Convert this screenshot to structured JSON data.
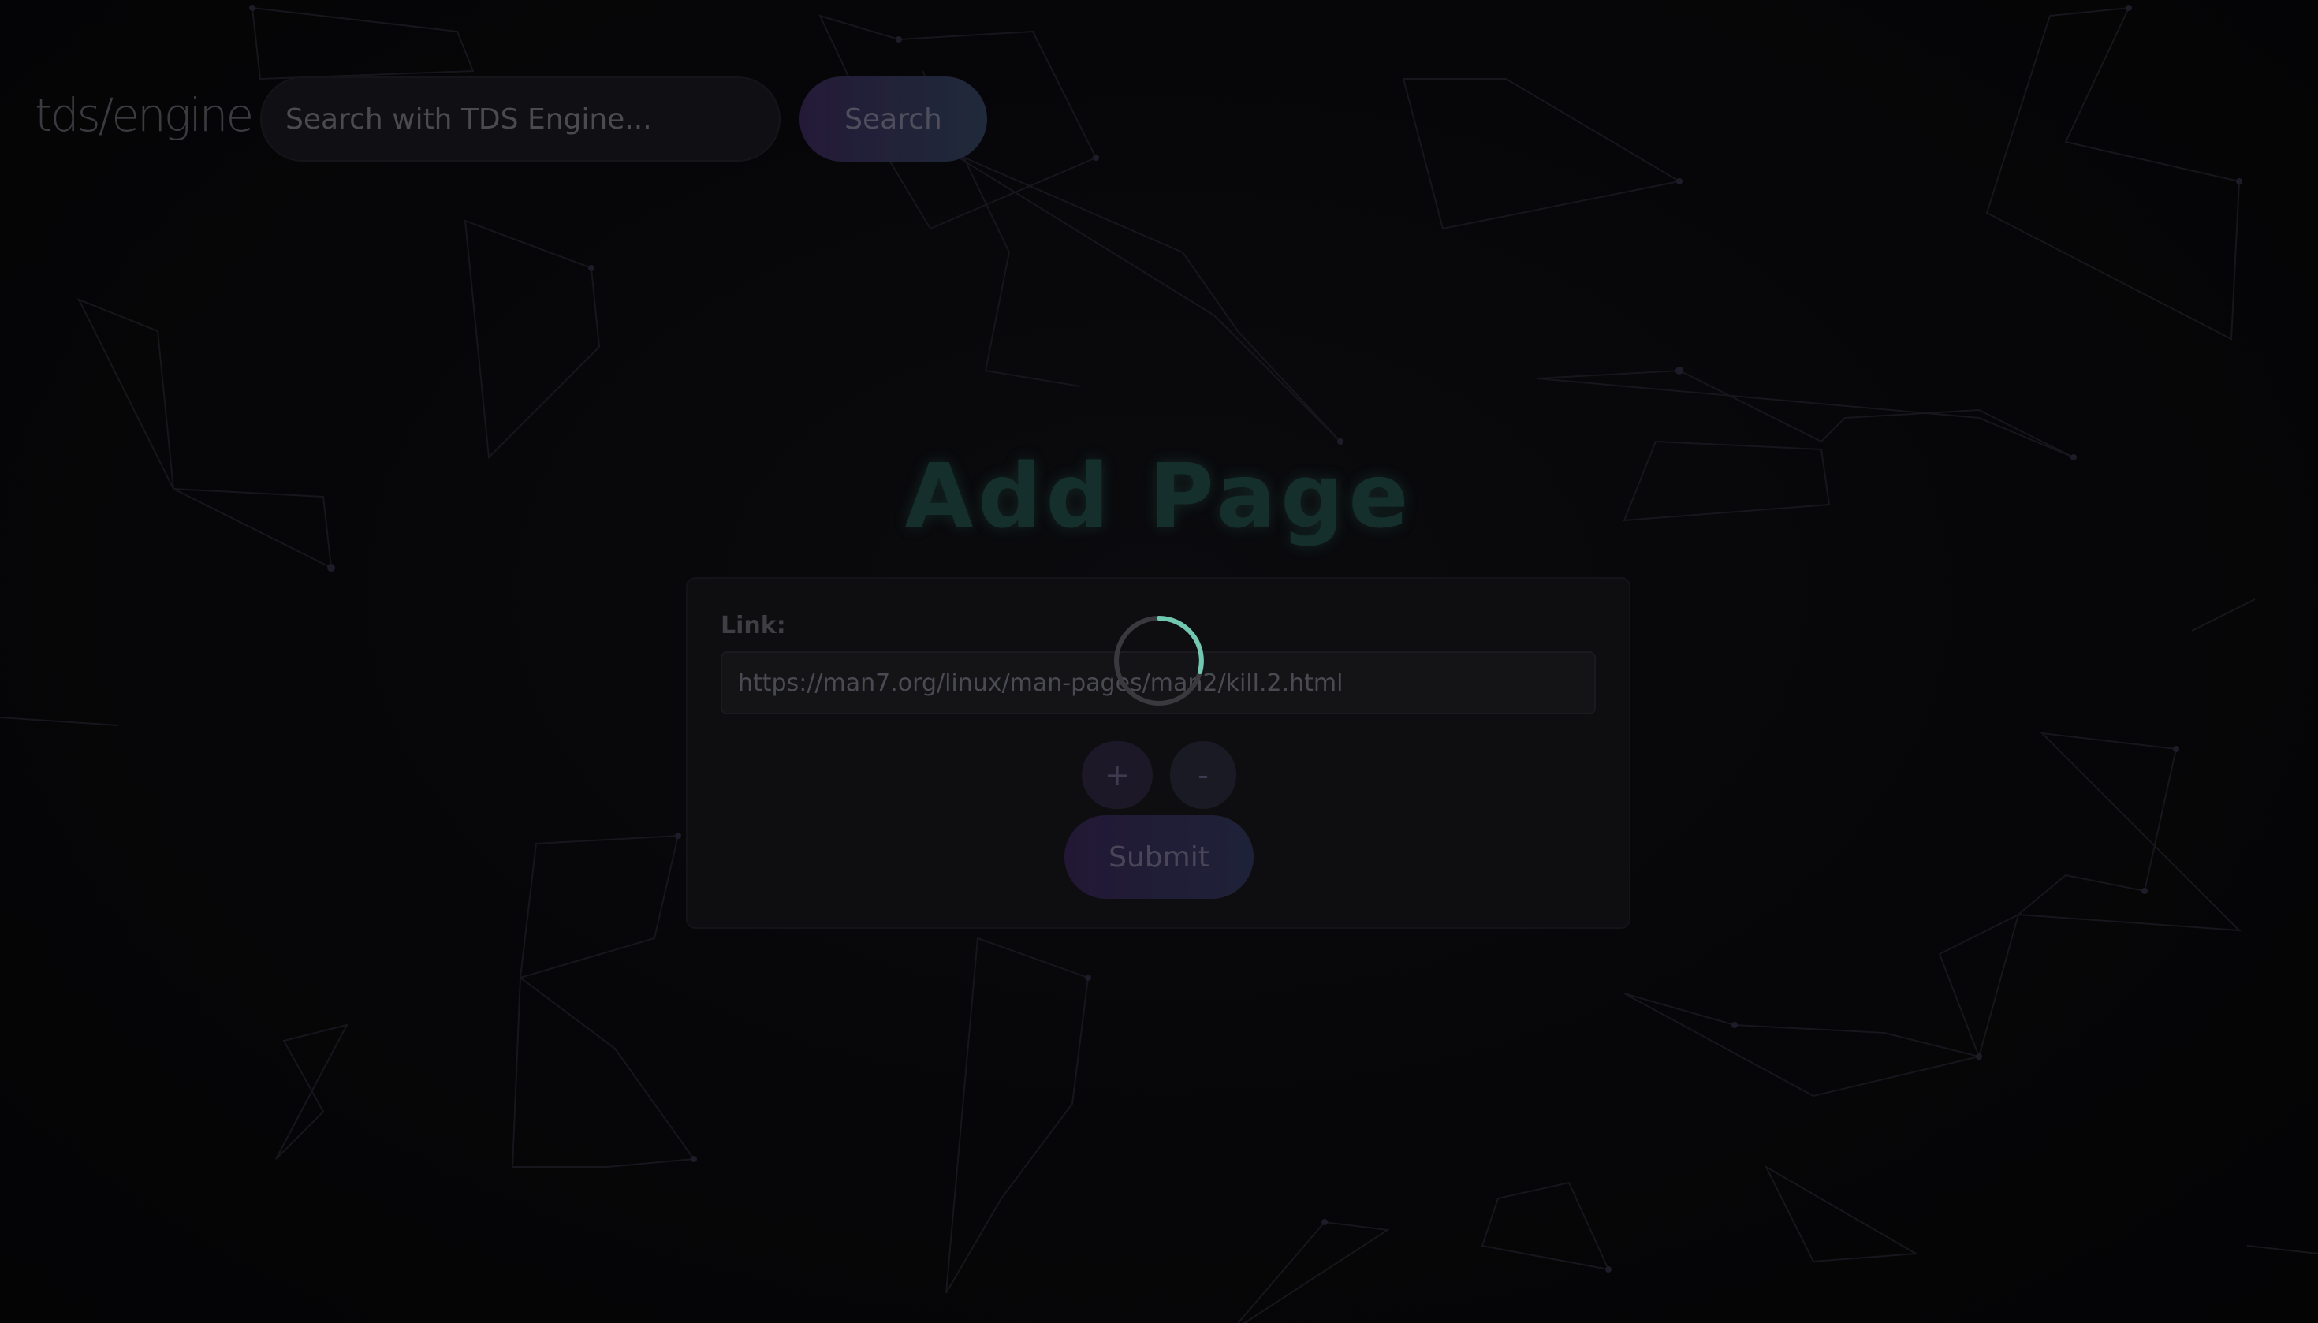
{
  "header": {
    "logo_text": "tds/engine",
    "search_placeholder": "Search with TDS Engine...",
    "search_button_label": "Search"
  },
  "main": {
    "title": "Add Page",
    "form": {
      "link_label": "Link:",
      "link_value": "https://man7.org/linux/man-pages/man2/kill.2.html",
      "add_button_label": "+",
      "remove_button_label": "-",
      "submit_label": "Submit"
    },
    "loading": true
  },
  "colors": {
    "background": "#060608",
    "accent_teal": "#6fc9b0",
    "button_gradient_start": "#241a38",
    "button_gradient_end": "#1f2a3a"
  },
  "icons": {
    "spinner": "loading-spinner-icon"
  }
}
